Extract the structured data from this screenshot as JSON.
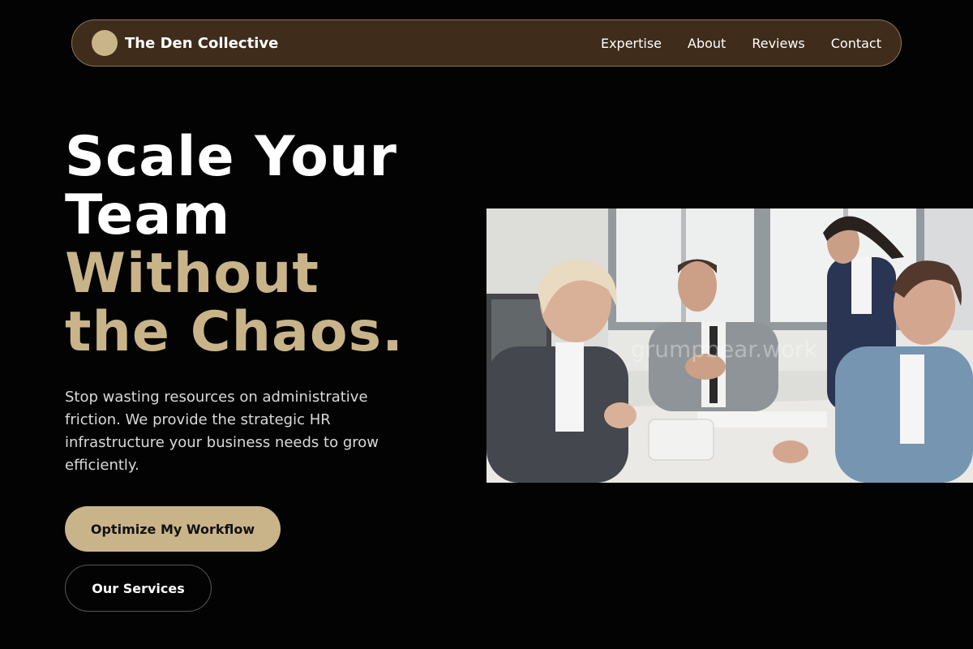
{
  "nav": {
    "brand": "The Den Collective",
    "links": [
      {
        "label": "Expertise"
      },
      {
        "label": "About"
      },
      {
        "label": "Reviews"
      },
      {
        "label": "Contact"
      }
    ]
  },
  "hero": {
    "headline_white_1": "Scale Your",
    "headline_white_2": "Team",
    "headline_accent_1": "Without",
    "headline_accent_2": "the Chaos.",
    "subtext": "Stop wasting resources on administrative friction. We provide the strategic HR infrastructure your business needs to grow efficiently.",
    "primary_cta": "Optimize My Workflow",
    "secondary_cta": "Our Services",
    "image_watermark": "grumpbear.work"
  },
  "colors": {
    "background": "#030303",
    "nav_bg": "#3f2c1b",
    "accent": "#c9b48a"
  },
  "icons": {
    "logo": "circle-logo-icon"
  }
}
